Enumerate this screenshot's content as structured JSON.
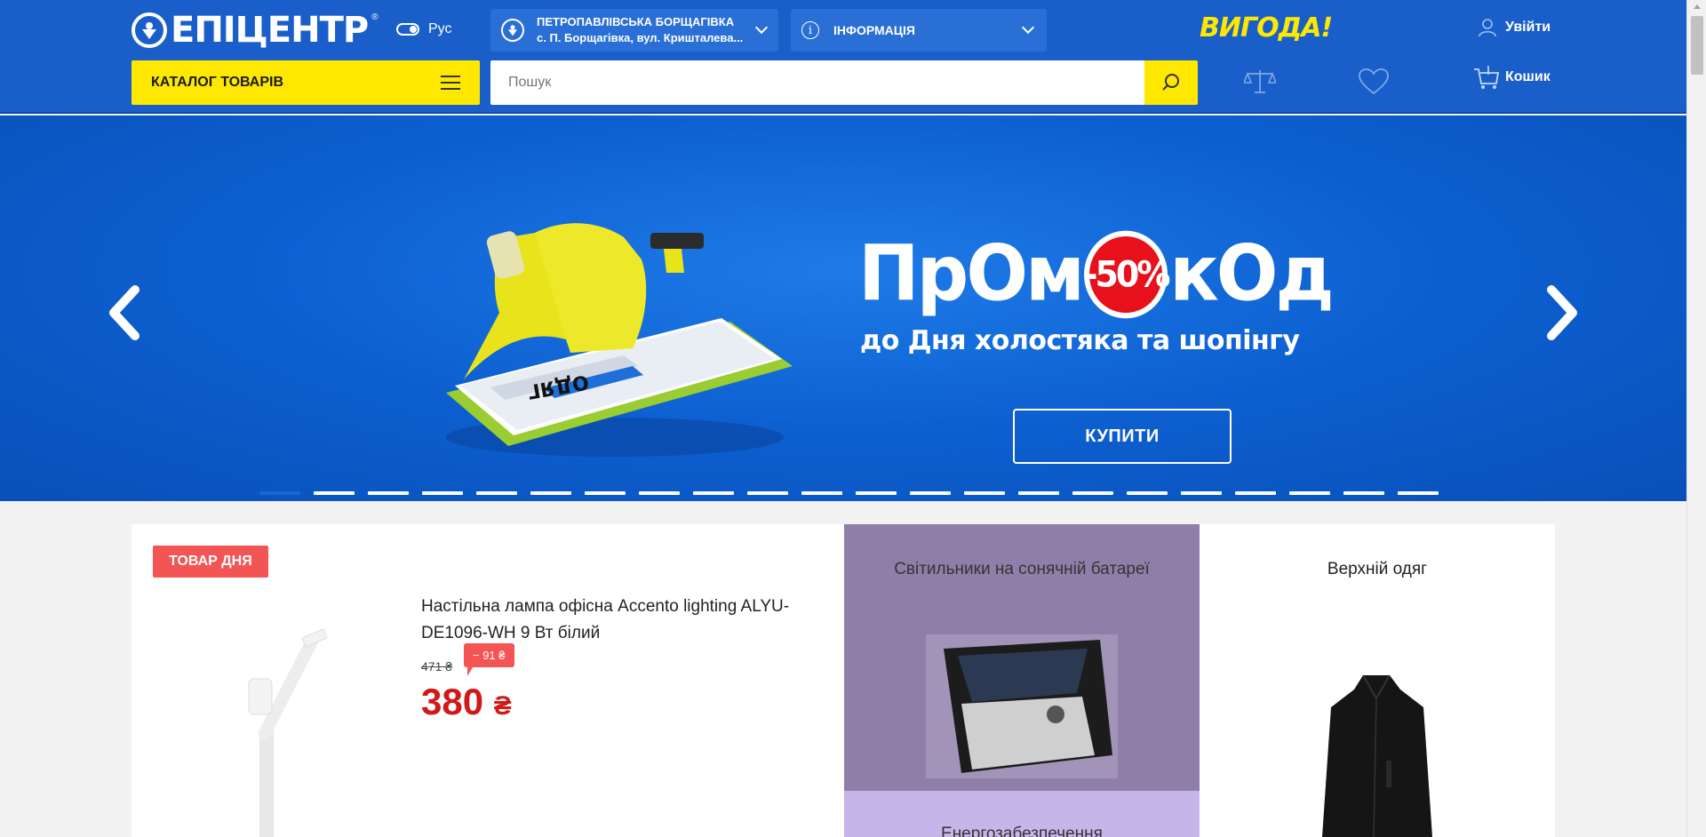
{
  "header": {
    "logo_text": "ЕПІЦЕНТР",
    "logo_reg": "®",
    "language": "Рус",
    "store": {
      "name": "ПЕТРОПАВЛІВСЬКА БОРЩАГІВКА",
      "address": "с. П. Борщагівка, вул. Кришталева..."
    },
    "info_label": "ІНФОРМАЦІЯ",
    "promo_label": "ВИГОДА!",
    "login_label": "Увійти",
    "catalog_label": "КАТАЛОГ ТОВАРІВ",
    "search_placeholder": "Пошук",
    "cart_label": "Кошик",
    "icons": {
      "compare": "scales-icon",
      "wishlist": "heart-icon",
      "cart": "cart-icon",
      "user": "user-icon",
      "search": "search-icon"
    },
    "colors": {
      "brand_blue": "#1a5fc9",
      "brand_yellow": "#ffe800"
    }
  },
  "banner": {
    "title_part1": "Пр",
    "title_o1": "О",
    "title_part2": "м",
    "title_badge": "-50%",
    "title_part3": "к",
    "title_o2": "О",
    "title_part4": "д",
    "subtitle": "до Дня холостяка та шопінгу",
    "button_label": "КУПИТИ",
    "phone_screen_text": "ОДЯГ",
    "slide_count": 22,
    "active_slide": 1
  },
  "product_of_day": {
    "badge": "ТОВАР ДНЯ",
    "title": "Настільна лампа офісна Accento lighting ALYU-DE1096-WH 9 Вт білий",
    "old_price": "471 ₴",
    "discount": "− 91 ₴",
    "price": "380",
    "currency": "₴"
  },
  "categories": [
    {
      "title": "Світильники на сонячній батареї"
    },
    {
      "title": "Енергозабезпечення"
    },
    {
      "title": "Верхній одяг"
    }
  ]
}
